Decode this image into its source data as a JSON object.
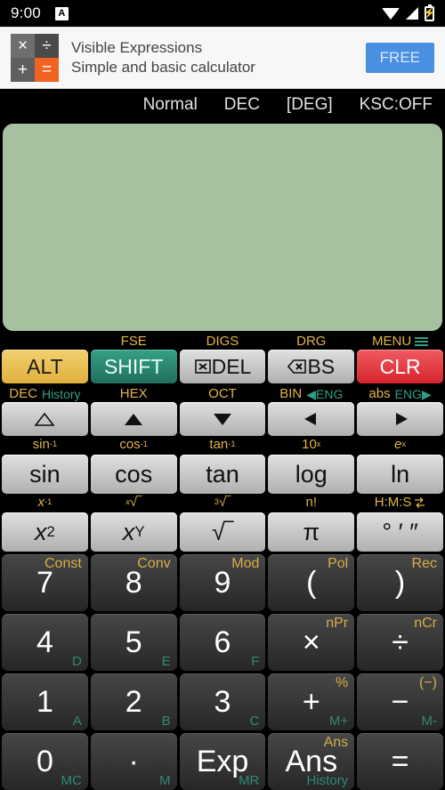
{
  "status_bar": {
    "time": "9:00",
    "app_badge": "A",
    "icons": [
      "wifi-icon",
      "signal-icon",
      "battery-charging-icon"
    ]
  },
  "ad": {
    "icon_glyphs": [
      "×",
      "÷",
      "+",
      "="
    ],
    "title": "Visible Expressions",
    "subtitle": "Simple and basic calculator",
    "cta": "FREE",
    "accent_color": "#4a90e2",
    "icon_accent": "#f26322"
  },
  "mode_row": {
    "mode": "Normal",
    "base": "DEC",
    "angle": "[DEG]",
    "ksc": "KSC:OFF"
  },
  "display": {
    "value": "",
    "bg_color": "#a7c0a0"
  },
  "rows": {
    "modifier": {
      "top": [
        "",
        "FSE",
        "DIGS",
        "DRG",
        "MENU"
      ],
      "main": [
        "ALT",
        "SHIFT",
        "DEL",
        "BS",
        "CLR"
      ],
      "bottom_primary": [
        "DEC",
        "HEX",
        "OCT",
        "BIN",
        "abs"
      ],
      "bottom_secondary": [
        "History",
        "",
        "",
        "ENG",
        "ENG"
      ]
    },
    "arrows": {
      "top_primary": [
        "DEC",
        "HEX",
        "OCT",
        "BIN",
        "abs"
      ],
      "top_secondary": [
        "History",
        "",
        "",
        "ENG",
        "ENG"
      ],
      "main": [
        "△",
        "▲",
        "▼",
        "◀",
        "▶"
      ],
      "main_names": [
        "up-outline-arrow",
        "up-arrow",
        "down-arrow",
        "left-arrow",
        "right-arrow"
      ],
      "bottom": [
        "sin-1",
        "cos-1",
        "tan-1",
        "10x",
        "ex"
      ]
    },
    "trig": {
      "top": [
        "sin⁻¹",
        "cos⁻¹",
        "tan⁻¹",
        "10ˣ",
        "eˣ"
      ],
      "main": [
        "sin",
        "cos",
        "tan",
        "log",
        "ln"
      ],
      "bottom": [
        "x⁻¹",
        "ˣ√",
        "³√",
        "n!",
        "H:M:S"
      ]
    },
    "power": {
      "top": [
        "x⁻¹",
        "ˣ√",
        "³√",
        "n!",
        "H:M:S"
      ],
      "main": [
        "x²",
        "xʸ",
        "√",
        "π",
        "° ′ ″"
      ]
    },
    "num1": {
      "keys": [
        "7",
        "8",
        "9",
        "(",
        ")"
      ],
      "top_labels": [
        "Const",
        "Conv",
        "Mod",
        "Pol",
        "Rec"
      ],
      "bottom_labels": [
        "",
        "",
        "",
        "",
        ""
      ]
    },
    "num2": {
      "keys": [
        "4",
        "5",
        "6",
        "×",
        "÷"
      ],
      "top_labels": [
        "",
        "",
        "",
        "nPr",
        "nCr"
      ],
      "bottom_labels": [
        "D",
        "E",
        "F",
        "",
        ""
      ]
    },
    "num3": {
      "keys": [
        "1",
        "2",
        "3",
        "+",
        "−"
      ],
      "top_labels": [
        "",
        "",
        "",
        "%",
        "(−)"
      ],
      "bottom_labels": [
        "A",
        "B",
        "C",
        "M+",
        "M-"
      ]
    },
    "num4": {
      "keys": [
        "0",
        "·",
        "Exp",
        "Ans",
        "="
      ],
      "top_labels": [
        "",
        "",
        "",
        "Ans",
        ""
      ],
      "bottom_labels": [
        "MC",
        "M",
        "MR",
        "History",
        ""
      ]
    }
  },
  "colors": {
    "gold": "#e0b447",
    "teal": "#2f9e87",
    "alt": "#e9c45f",
    "shift": "#2b8571",
    "clr": "#e8404a"
  }
}
